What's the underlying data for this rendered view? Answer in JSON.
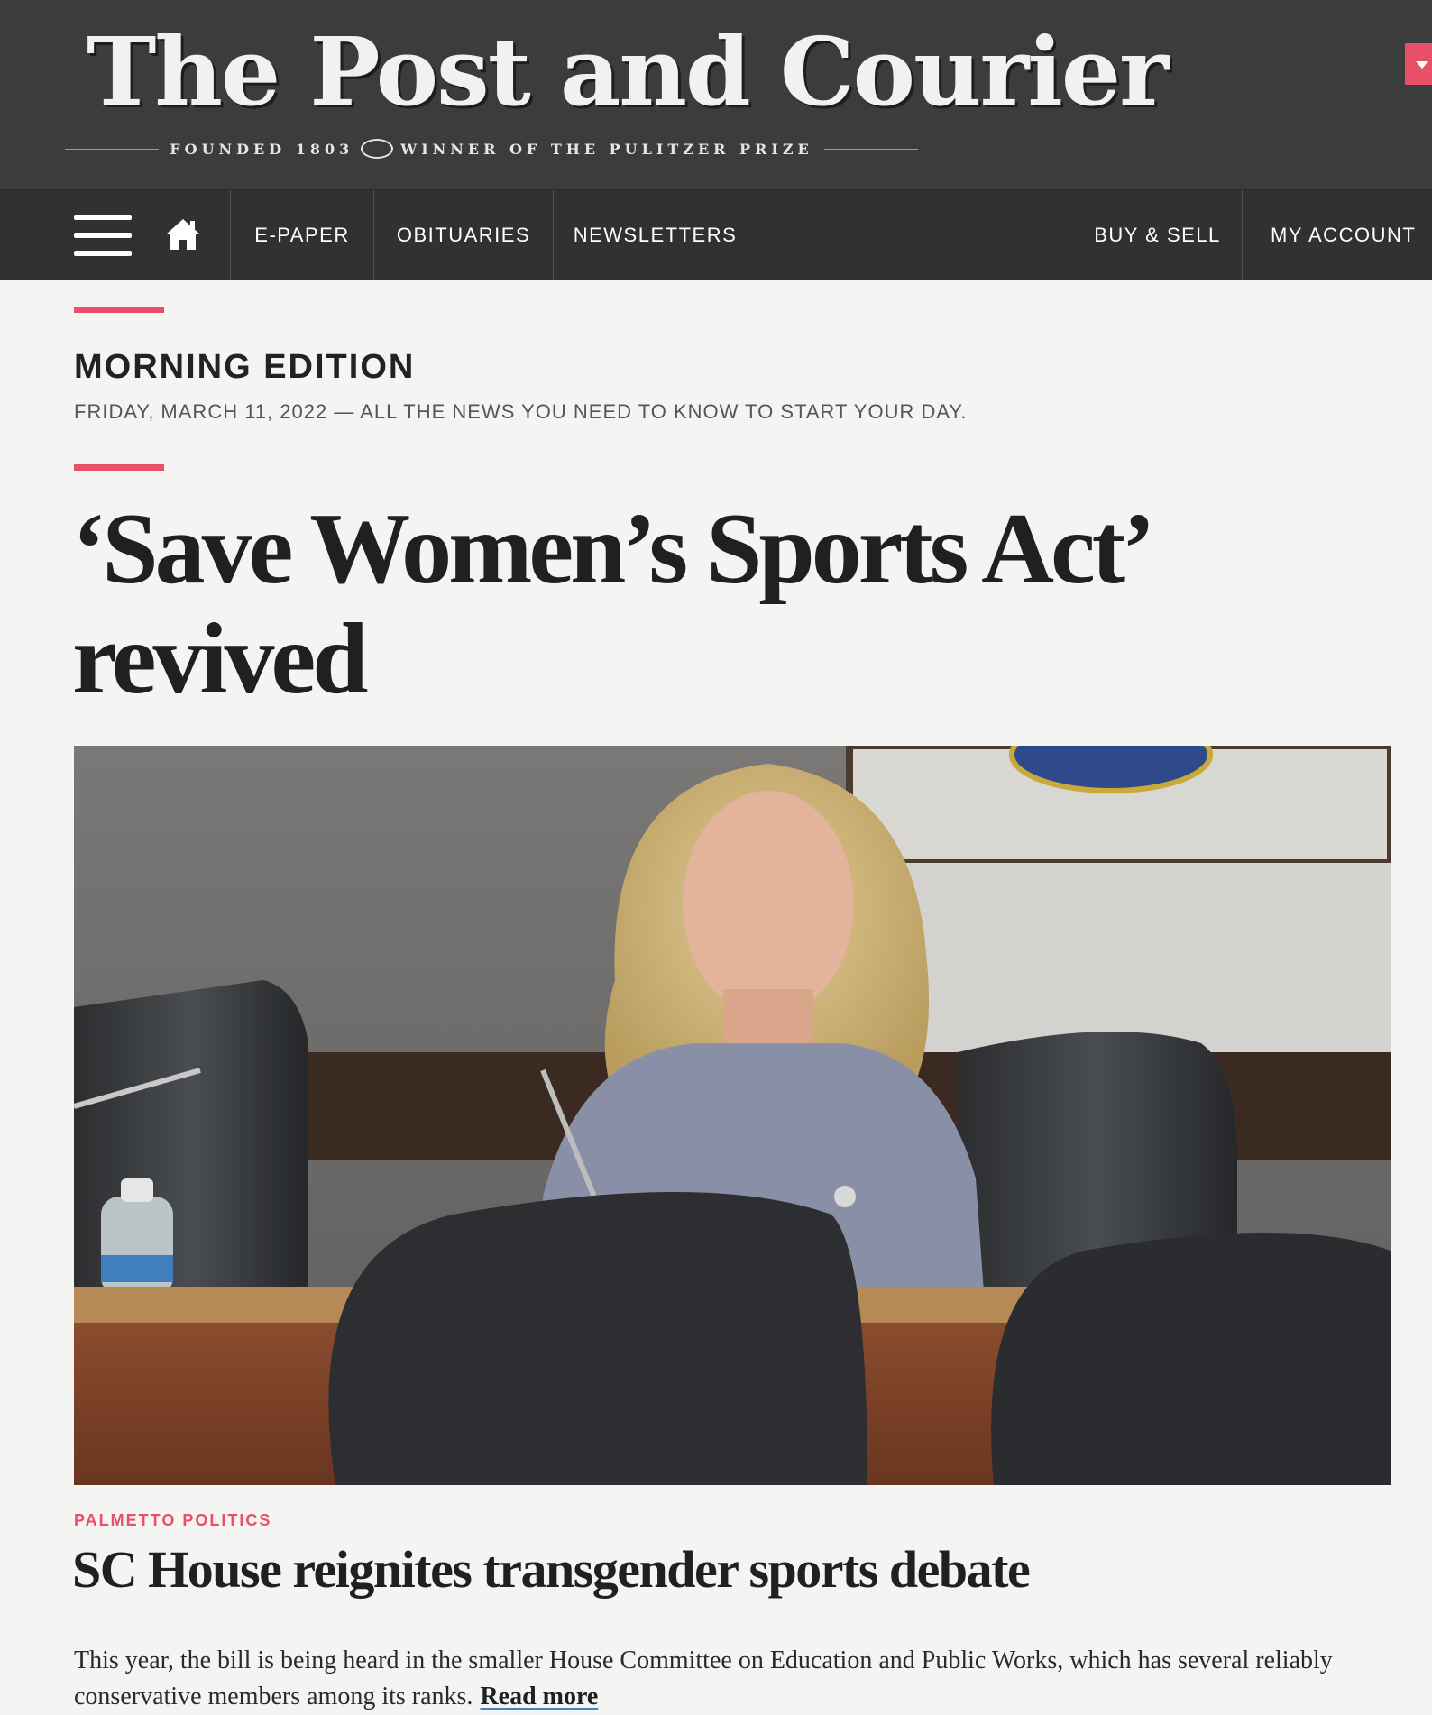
{
  "masthead": {
    "logo": "The Post and Courier",
    "tagline_left": "FOUNDED 1803",
    "tagline_right": "WINNER OF THE PULITZER PRIZE"
  },
  "nav": {
    "menu_icon": "hamburger-menu-icon",
    "home_icon": "home-icon",
    "items": [
      {
        "label": "E-PAPER"
      },
      {
        "label": "OBITUARIES"
      },
      {
        "label": "NEWSLETTERS"
      },
      {
        "label": "BUY & SELL"
      },
      {
        "label": "MY ACCOUNT"
      }
    ]
  },
  "edition": {
    "title": "MORNING EDITION",
    "subtitle": "FRIDAY, MARCH 11, 2022 — ALL THE NEWS YOU NEED TO KNOW TO START YOUR DAY."
  },
  "main": {
    "headline": "‘Save Women’s Sports Act’ revived"
  },
  "story": {
    "kicker": "PALMETTO POLITICS",
    "title": "SC House reignites transgender sports debate",
    "summary": "This year, the bill is being heard in the smaller House Committee on Education and Public Works, which has several reliably conservative members among its ranks.",
    "read_more": "Read more"
  },
  "colors": {
    "masthead_bg": "#3a3d3b",
    "nav_bg": "#2f3231",
    "accent": "#e8506a",
    "page_bg": "#f4f4f2"
  }
}
